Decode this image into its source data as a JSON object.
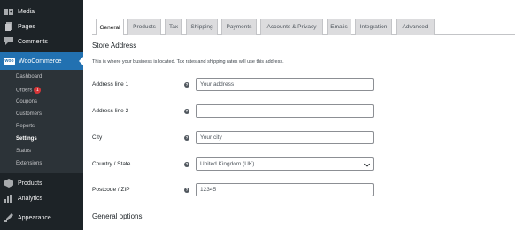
{
  "sidebar": {
    "top_items": [
      {
        "label": "Media",
        "icon": "media-icon"
      },
      {
        "label": "Pages",
        "icon": "pages-icon"
      },
      {
        "label": "Comments",
        "icon": "comments-icon"
      }
    ],
    "woocommerce": {
      "label": "WooCommerce",
      "logo_text": "woo"
    },
    "submenu": [
      {
        "label": "Dashboard"
      },
      {
        "label": "Orders",
        "badge": "1"
      },
      {
        "label": "Coupons"
      },
      {
        "label": "Customers"
      },
      {
        "label": "Reports"
      },
      {
        "label": "Settings"
      },
      {
        "label": "Status"
      },
      {
        "label": "Extensions"
      }
    ],
    "bottom_items": [
      {
        "label": "Products",
        "icon": "products-icon"
      },
      {
        "label": "Analytics",
        "icon": "analytics-icon"
      },
      {
        "label": "Appearance",
        "icon": "appearance-icon"
      }
    ]
  },
  "tabs": [
    "General",
    "Products",
    "Tax",
    "Shipping",
    "Payments",
    "Accounts & Privacy",
    "Emails",
    "Integration",
    "Advanced"
  ],
  "active_tab": "General",
  "store_address": {
    "title": "Store Address",
    "description": "This is where your business is located. Tax rates and shipping rates will use this address."
  },
  "fields": [
    {
      "label": "Address line 1",
      "value": "Your address",
      "placeholder": ""
    },
    {
      "label": "Address line 2",
      "value": "",
      "placeholder": ""
    },
    {
      "label": "City",
      "value": "Your city",
      "placeholder": ""
    },
    {
      "label": "Country / State",
      "value": "United Kingdom (UK)",
      "type": "select"
    },
    {
      "label": "Postcode / ZIP",
      "value": "12345",
      "placeholder": ""
    }
  ],
  "general_options": {
    "title": "General options"
  },
  "help_glyph": "?",
  "colors": {
    "sidebar_bg": "#1d2327",
    "accent": "#2271b1",
    "badge": "#d63638"
  }
}
